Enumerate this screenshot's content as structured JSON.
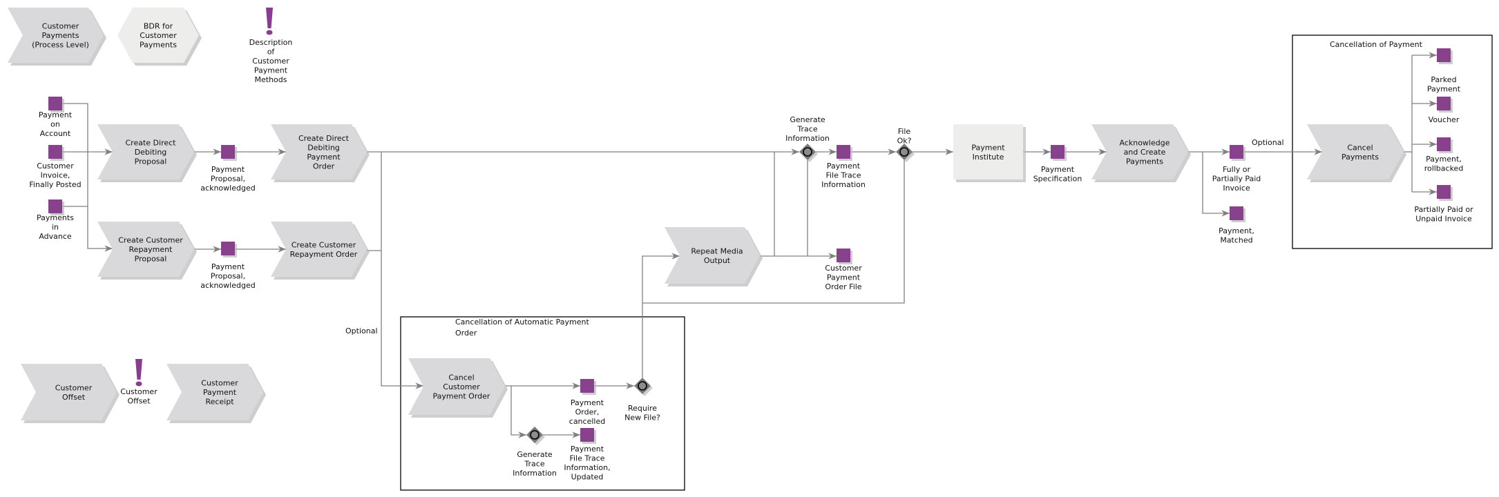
{
  "colors": {
    "function": "#d9d9db",
    "interface": "#ededeb",
    "event": "#87418d",
    "connector": "#7a7a7a",
    "edge": "#808080",
    "exclamation": "#8a3b92"
  },
  "nodes": {
    "process_customer_payments": {
      "type": "process-interface",
      "lines": [
        "Customer",
        "Payments",
        "(Process Level)"
      ]
    },
    "bdr": {
      "type": "interface",
      "lines": [
        "BDR for",
        "Customer",
        "Payments"
      ]
    },
    "desc_methods": {
      "type": "information",
      "icon": "exclamation-icon",
      "lines": [
        "Description",
        "of",
        "Customer",
        "Payment",
        "Methods"
      ]
    },
    "payment_on_account": {
      "type": "event",
      "lines": [
        "Payment",
        "on",
        "Account"
      ]
    },
    "customer_invoice": {
      "type": "event",
      "lines": [
        "Customer",
        "Invoice,",
        "Finally Posted"
      ]
    },
    "payments_in_advance": {
      "type": "event",
      "lines": [
        "Payments",
        "in",
        "Advance"
      ]
    },
    "create_dd_proposal": {
      "type": "function",
      "lines": [
        "Create Direct",
        "Debiting",
        "Proposal"
      ]
    },
    "pp_ack_1": {
      "type": "event",
      "lines": [
        "Payment",
        "Proposal,",
        "acknowledged"
      ]
    },
    "create_dd_order": {
      "type": "function",
      "lines": [
        "Create Direct",
        "Debiting",
        "Payment",
        "Order"
      ]
    },
    "create_repay_proposal": {
      "type": "function",
      "lines": [
        "Create Customer",
        "Repayment",
        "Proposal"
      ]
    },
    "pp_ack_2": {
      "type": "event",
      "lines": [
        "Payment",
        "Proposal,",
        "acknowledged"
      ]
    },
    "create_repay_order": {
      "type": "function",
      "lines": [
        "Create Customer",
        "Repayment Order"
      ]
    },
    "cancel_cpo": {
      "type": "function",
      "lines": [
        "Cancel",
        "Customer",
        "Payment Order"
      ]
    },
    "po_cancelled": {
      "type": "event",
      "lines": [
        "Payment",
        "Order,",
        "cancelled"
      ]
    },
    "gen_trace_2": {
      "type": "connector",
      "lines": [
        "Generate",
        "Trace",
        "Information"
      ]
    },
    "pfti_updated": {
      "type": "event",
      "lines": [
        "Payment",
        "File Trace",
        "Information,",
        "Updated"
      ]
    },
    "require_new_file": {
      "type": "connector",
      "lines": [
        "Require",
        "New File?"
      ]
    },
    "repeat_media": {
      "type": "function",
      "lines": [
        "Repeat Media",
        "Output"
      ]
    },
    "gen_trace_1": {
      "type": "connector",
      "lines": [
        "Generate",
        "Trace",
        "Information"
      ]
    },
    "pfti": {
      "type": "event",
      "lines": [
        "Payment",
        "File Trace",
        "Information"
      ]
    },
    "cpo_file": {
      "type": "event",
      "lines": [
        "Customer",
        "Payment",
        "Order File"
      ]
    },
    "file_ok": {
      "type": "connector",
      "lines": [
        "File",
        "Ok?"
      ]
    },
    "payment_institute": {
      "type": "organization",
      "lines": [
        "Payment",
        "Institute"
      ]
    },
    "payment_spec": {
      "type": "event",
      "lines": [
        "Payment",
        "Specification"
      ]
    },
    "ack_create": {
      "type": "function",
      "lines": [
        "Acknowledge",
        "and Create",
        "Payments"
      ]
    },
    "fully_paid": {
      "type": "event",
      "lines": [
        "Fully or",
        "Partially Paid",
        "Invoice"
      ]
    },
    "payment_matched": {
      "type": "event",
      "lines": [
        "Payment,",
        "Matched"
      ]
    },
    "cancel_payments": {
      "type": "function",
      "lines": [
        "Cancel",
        "Payments"
      ]
    },
    "parked": {
      "type": "event",
      "lines": [
        "Parked",
        "Payment"
      ]
    },
    "voucher": {
      "type": "event",
      "lines": [
        "Voucher"
      ]
    },
    "rollbacked": {
      "type": "event",
      "lines": [
        "Payment,",
        "rollbacked"
      ]
    },
    "partially_unpaid": {
      "type": "event",
      "lines": [
        "Partially Paid or",
        "Unpaid Invoice"
      ]
    },
    "customer_offset": {
      "type": "process-interface",
      "lines": [
        "Customer",
        "Offset"
      ]
    },
    "offset_info": {
      "type": "information",
      "icon": "exclamation-icon",
      "lines": [
        "Customer",
        "Offset"
      ]
    },
    "payment_receipt": {
      "type": "process-interface",
      "lines": [
        "Customer",
        "Payment",
        "Receipt"
      ]
    }
  },
  "groups": {
    "cancel_auto": {
      "title_lines": [
        "Cancellation of Automatic Payment",
        "Order"
      ]
    },
    "cancel_payment": {
      "title_lines": [
        "Cancellation of Payment"
      ]
    }
  },
  "edge_labels": {
    "optional_1": "Optional",
    "optional_2": "Optional"
  }
}
